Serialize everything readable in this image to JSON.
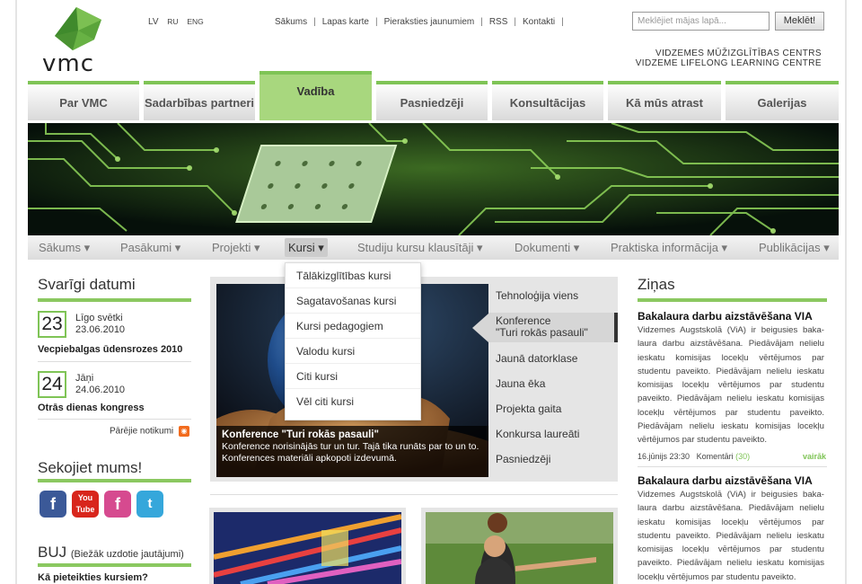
{
  "header": {
    "logo_text": "vmc",
    "languages": [
      "LV",
      "RU",
      "ENG"
    ],
    "top_links": [
      "Sākums",
      "Lapas karte",
      "Pieraksties jaunumiem",
      "RSS",
      "Kontakti"
    ],
    "search": {
      "placeholder": "Meklējiet mājas lapā...",
      "button": "Meklēt!"
    },
    "centre_name_lv": "VIDZEMES MŪŽIZGLĪTĪBAS CENTRS",
    "centre_name_en": "VIDZEME LIFELONG LEARNING CENTRE"
  },
  "main_tabs": [
    "Par VMC",
    "Sadarbības partneri",
    "Vadība",
    "Pasniedzēji",
    "Konsultācijas",
    "Kā mūs atrast",
    "Galerijas"
  ],
  "sub_nav": [
    "Sākums",
    "Pasākumi",
    "Projekti",
    "Kursi",
    "Studiju kursu klausītāji",
    "Dokumenti",
    "Praktiska informācija",
    "Publikācijas"
  ],
  "dropdown": [
    "Tālākizglītības kursi",
    "Sagatavošanas kursi",
    "Kursi pedagogiem",
    "Valodu kursi",
    "Citi kursi",
    "Vēl citi kursi"
  ],
  "important_dates": {
    "title": "Svarīgi datumi",
    "events": [
      {
        "day": "23",
        "name": "Līgo svētki",
        "date": "23.06.2010",
        "headline": "Vecpiebalgas ūdensrozes 2010"
      },
      {
        "day": "24",
        "name": "Jāņi",
        "date": "24.06.2010",
        "headline": "Otrās dienas kongress"
      }
    ],
    "other_events": "Pārējie notikumi"
  },
  "follow": {
    "title": "Sekojiet mums!",
    "icons": [
      "facebook-icon",
      "youtube-icon",
      "facebook-pink-icon",
      "twitter-icon"
    ]
  },
  "faq": {
    "title": "BUJ",
    "subtitle": "(Biežāk uzdotie jautājumi)",
    "question": "Kā pieteikties kursiem?"
  },
  "featured": {
    "caption_title": "Konference \"Turi rokās pasauli\"",
    "caption_text": "Konference norisinājās tur un tur. Tajā tika runāts par to un to. Konferences materiāli apkopoti izdevumā.",
    "list": [
      "Tehnoloģija viens",
      "Konference\n\"Turi rokās pasauli\"",
      "Jaunā datorklase",
      "Jauna ēka",
      "Projekta gaita",
      "Konkursa laureāti",
      "Pasniedzēji"
    ]
  },
  "news": {
    "title": "Ziņas",
    "items": [
      {
        "title": "Bakalaura darbu aizstāvēšana VIA",
        "text": "Vidzemes Augstskolā (ViA) ir beigusies baka-laura darbu aizstāvēšana. Piedāvājam nelielu ieskatu komisijas locekļu vērtējumos par studentu paveikto. Piedāvājam nelielu ieskatu komisijas locekļu vērtējumos par studentu paveikto. Piedāvājam nelielu ieskatu komisijas locekļu vērtējumos par studentu paveikto. Piedāvājam nelielu ieskatu komisijas locekļu vērtējumos par studentu paveikto.",
        "date": "16.jūnijs 23:30",
        "comments_label": "Komentāri",
        "comments_count": "(30)",
        "more": "vairāk"
      },
      {
        "title": "Bakalaura darbu aizstāvēšana VIA",
        "text": "Vidzemes Augstskolā (ViA) ir beigusies baka-laura darbu aizstāvēšana. Piedāvājam nelielu ieskatu komisijas locekļu vērtējumos par studentu paveikto. Piedāvājam nelielu ieskatu komisijas locekļu vērtējumos par studentu paveikto. Piedāvājam nelielu ieskatu komisijas locekļu vērtējumos par studentu paveikto."
      }
    ]
  },
  "colors": {
    "accent_green": "#7fc456",
    "active_tab": "#a8d77e",
    "rss_orange": "#f26b1d"
  }
}
